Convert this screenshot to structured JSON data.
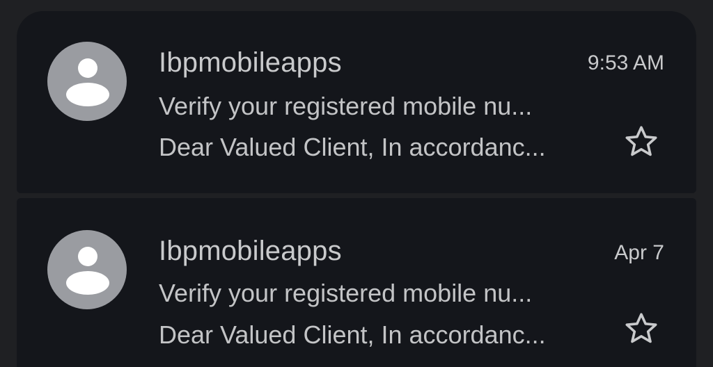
{
  "messages": [
    {
      "sender": "Ibpmobileapps",
      "time": "9:53 AM",
      "subject": "Verify your registered mobile nu...",
      "snippet": "Dear Valued Client, In accordanc...",
      "avatar_icon": "person-icon",
      "star_icon": "star-outline-icon",
      "starred": false
    },
    {
      "sender": "Ibpmobileapps",
      "time": "Apr 7",
      "subject": "Verify your registered mobile nu...",
      "snippet": "Dear Valued Client, In accordanc...",
      "avatar_icon": "person-icon",
      "star_icon": "star-outline-icon",
      "starred": false
    }
  ],
  "colors": {
    "background": "#1f2023",
    "card": "#14161b",
    "text": "#c9cacc",
    "avatar": "#9a9ca1"
  }
}
